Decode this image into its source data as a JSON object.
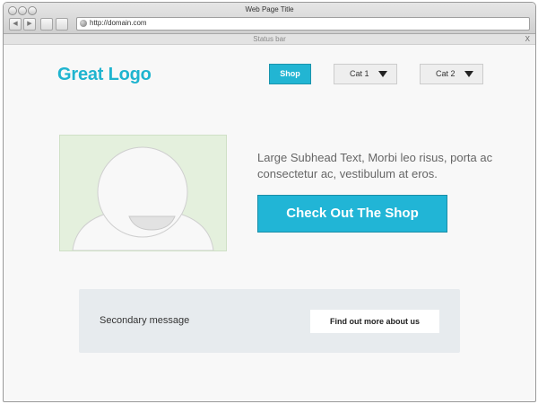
{
  "browser": {
    "title": "Web Page Title",
    "url": "http://domain.com"
  },
  "statusbar": {
    "text": "Status bar",
    "close": "X"
  },
  "header": {
    "logo": "Great Logo",
    "nav": {
      "shop": "Shop",
      "cat1": "Cat 1",
      "cat2": "Cat 2"
    }
  },
  "hero": {
    "subhead": "Large Subhead Text, Morbi leo risus, porta ac consectetur ac, vestibulum at eros.",
    "cta": "Check Out The Shop"
  },
  "secondary": {
    "message": "Secondary message",
    "button": "Find out more about us"
  },
  "colors": {
    "accent": "#22b5d3",
    "image_placeholder": "#e4f0dd",
    "secondary_bg": "#e7ebee"
  }
}
